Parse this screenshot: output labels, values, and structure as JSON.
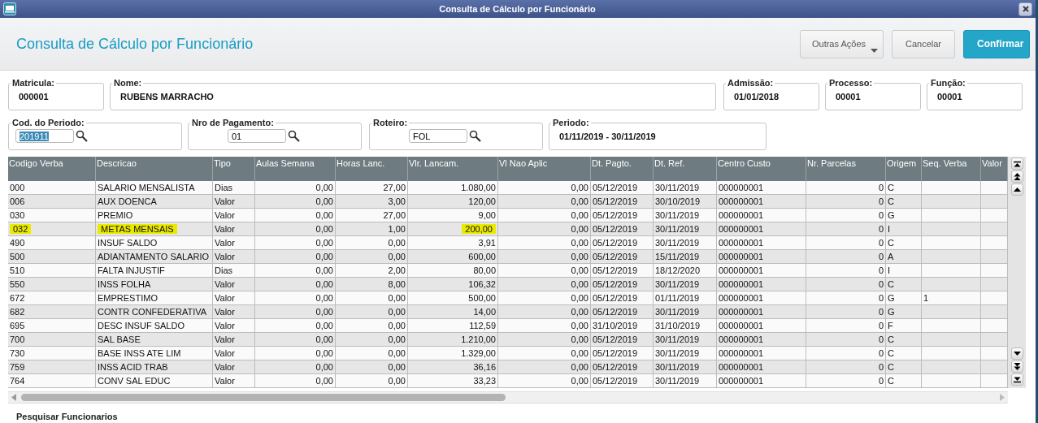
{
  "window": {
    "title": "Consulta de Cálculo por Funcionário"
  },
  "header": {
    "title": "Consulta de Cálculo por Funcionário",
    "buttons": [
      {
        "label": "Outras Ações",
        "kind": "menu"
      },
      {
        "label": "Cancelar",
        "kind": "secondary"
      },
      {
        "label": "Confirmar",
        "kind": "primary"
      }
    ]
  },
  "fields_row_1": [
    {
      "label": "Matricula:",
      "value": "000001"
    },
    {
      "label": "Nome:",
      "value": "RUBENS MARRACHO"
    },
    {
      "label": "Admissão:",
      "value": "01/01/2018"
    },
    {
      "label": "Processo:",
      "value": "00001"
    },
    {
      "label": "Função:",
      "value": "00001"
    }
  ],
  "fields_row_2": [
    {
      "label": "Cod. do Periodo:",
      "value": "201911",
      "kind": "lookup",
      "selected": true
    },
    {
      "label": "Nro de Pagamento:",
      "value": "01",
      "kind": "lookup",
      "selected": false
    },
    {
      "label": "Roteiro:",
      "value": "FOL",
      "kind": "lookup",
      "selected": false
    },
    {
      "label": "Periodo:",
      "value": "01/11/2019 - 30/11/2019",
      "kind": "display"
    }
  ],
  "table": {
    "columns": [
      "Codigo Verba",
      "Descricao",
      "Tipo",
      "Aulas Semana",
      "Horas Lanc.",
      "Vlr. Lancam.",
      "Vl Nao Aplic",
      "Dt. Pagto.",
      "Dt. Ref.",
      "Centro Custo",
      "Nr. Parcelas",
      "Origem",
      "Seq. Verba",
      "Valor"
    ],
    "rows": [
      {
        "highlighted": false,
        "cells": [
          "000",
          "SALARIO MENSALISTA",
          "Dias",
          "0,00",
          "27,00",
          "1.080,00",
          "0,00",
          "05/12/2019",
          "30/11/2019",
          "000000001",
          "0",
          "C",
          "",
          ""
        ]
      },
      {
        "highlighted": false,
        "cells": [
          "006",
          "AUX DOENCA",
          "Valor",
          "0,00",
          "3,00",
          "120,00",
          "0,00",
          "05/12/2019",
          "30/10/2019",
          "000000001",
          "0",
          "C",
          "",
          ""
        ]
      },
      {
        "highlighted": false,
        "cells": [
          "030",
          "PREMIO",
          "Valor",
          "0,00",
          "27,00",
          "9,00",
          "0,00",
          "05/12/2019",
          "30/11/2019",
          "000000001",
          "0",
          "G",
          "",
          ""
        ]
      },
      {
        "highlighted": true,
        "cells": [
          "032",
          "METAS MENSAIS",
          "Valor",
          "0,00",
          "1,00",
          "200,00",
          "0,00",
          "05/12/2019",
          "30/11/2019",
          "000000001",
          "0",
          "I",
          "",
          ""
        ]
      },
      {
        "highlighted": false,
        "cells": [
          "490",
          "INSUF SALDO",
          "Valor",
          "0,00",
          "0,00",
          "3,91",
          "0,00",
          "05/12/2019",
          "30/11/2019",
          "000000001",
          "0",
          "C",
          "",
          ""
        ]
      },
      {
        "highlighted": false,
        "cells": [
          "500",
          "ADIANTAMENTO SALARIO",
          "Valor",
          "0,00",
          "0,00",
          "600,00",
          "0,00",
          "05/12/2019",
          "15/11/2019",
          "000000001",
          "0",
          "A",
          "",
          ""
        ]
      },
      {
        "highlighted": false,
        "cells": [
          "510",
          "FALTA INJUSTIF",
          "Dias",
          "0,00",
          "2,00",
          "80,00",
          "0,00",
          "05/12/2019",
          "18/12/2020",
          "000000001",
          "0",
          "I",
          "",
          ""
        ]
      },
      {
        "highlighted": false,
        "cells": [
          "550",
          "INSS FOLHA",
          "Valor",
          "0,00",
          "8,00",
          "106,32",
          "0,00",
          "05/12/2019",
          "30/11/2019",
          "000000001",
          "0",
          "C",
          "",
          ""
        ]
      },
      {
        "highlighted": false,
        "cells": [
          "672",
          "EMPRESTIMO",
          "Valor",
          "0,00",
          "0,00",
          "500,00",
          "0,00",
          "05/12/2019",
          "01/11/2019",
          "000000001",
          "0",
          "G",
          "1",
          ""
        ]
      },
      {
        "highlighted": false,
        "cells": [
          "682",
          "CONTR CONFEDERATIVA",
          "Valor",
          "0,00",
          "0,00",
          "14,00",
          "0,00",
          "05/12/2019",
          "30/11/2019",
          "000000001",
          "0",
          "G",
          "",
          ""
        ]
      },
      {
        "highlighted": false,
        "cells": [
          "695",
          "DESC INSUF SALDO",
          "Valor",
          "0,00",
          "0,00",
          "112,59",
          "0,00",
          "31/10/2019",
          "31/10/2019",
          "000000001",
          "0",
          "F",
          "",
          ""
        ]
      },
      {
        "highlighted": false,
        "cells": [
          "700",
          "SAL BASE",
          "Valor",
          "0,00",
          "0,00",
          "1.210,00",
          "0,00",
          "05/12/2019",
          "30/11/2019",
          "000000001",
          "0",
          "C",
          "",
          ""
        ]
      },
      {
        "highlighted": false,
        "cells": [
          "730",
          "BASE INSS ATE LIM",
          "Valor",
          "0,00",
          "0,00",
          "1.329,00",
          "0,00",
          "05/12/2019",
          "30/11/2019",
          "000000001",
          "0",
          "C",
          "",
          ""
        ]
      },
      {
        "highlighted": false,
        "cells": [
          "759",
          "INSS ACID TRAB",
          "Valor",
          "0,00",
          "0,00",
          "36,16",
          "0,00",
          "05/12/2019",
          "30/11/2019",
          "000000001",
          "0",
          "C",
          "",
          ""
        ]
      },
      {
        "highlighted": false,
        "cells": [
          "764",
          "CONV SAL EDUC",
          "Valor",
          "0,00",
          "0,00",
          "33,23",
          "0,00",
          "05/12/2019",
          "30/11/2019",
          "000000001",
          "0",
          "C",
          "",
          ""
        ]
      }
    ]
  },
  "footer": {
    "section_title": "Pesquisar Funcionarios"
  }
}
